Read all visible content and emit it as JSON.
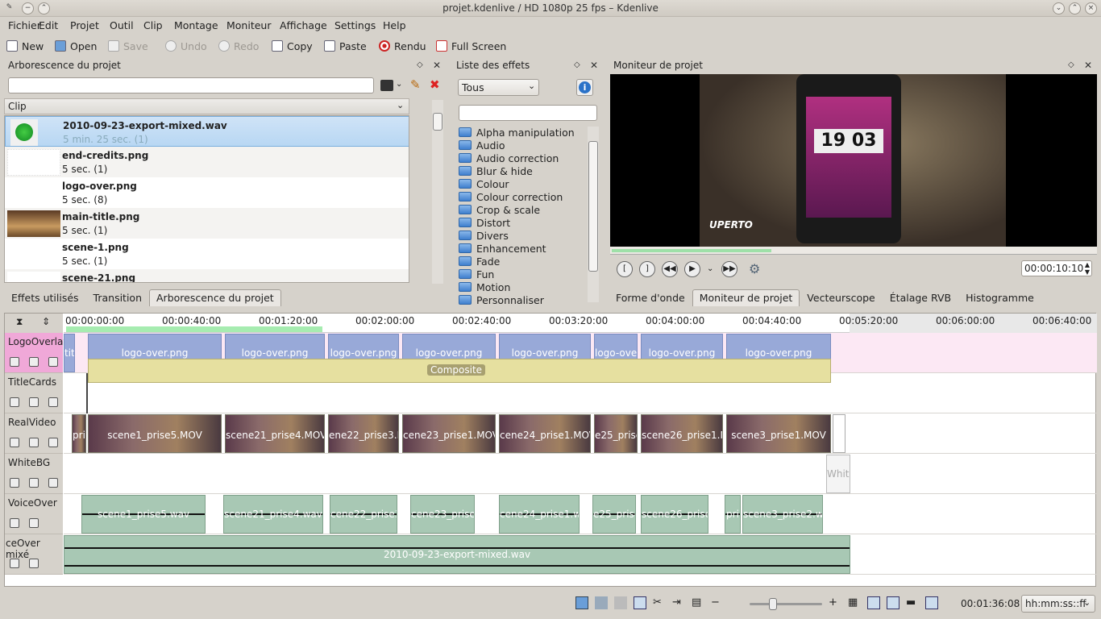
{
  "window": {
    "title": "projet.kdenlive / HD 1080p 25 fps – Kdenlive"
  },
  "menu": [
    "Fichier",
    "Edit",
    "Projet",
    "Outil",
    "Clip",
    "Montage",
    "Moniteur",
    "Affichage",
    "Settings",
    "Help"
  ],
  "toolbar": {
    "new": "New",
    "open": "Open",
    "save": "Save",
    "undo": "Undo",
    "redo": "Redo",
    "copy": "Copy",
    "paste": "Paste",
    "render": "Rendu",
    "fullscreen": "Full Screen"
  },
  "project_tree": {
    "title": "Arborescence du projet",
    "search_value": "",
    "column_header": "Clip",
    "clips": [
      {
        "name": "2010-09-23-export-mixed.wav",
        "duration": "5 min. 25 sec. (1)"
      },
      {
        "name": "end-credits.png",
        "duration": "5 sec. (1)"
      },
      {
        "name": "logo-over.png",
        "duration": "5 sec. (8)"
      },
      {
        "name": "main-title.png",
        "duration": "5 sec. (1)"
      },
      {
        "name": "scene-1.png",
        "duration": "5 sec. (1)"
      },
      {
        "name": "scene-21.png",
        "duration": ""
      }
    ]
  },
  "left_tabs": [
    "Effets utilisés",
    "Transition",
    "Arborescence du projet"
  ],
  "effects": {
    "title": "Liste des effets",
    "filter": "Tous",
    "search_value": "",
    "items": [
      "Alpha manipulation",
      "Audio",
      "Audio correction",
      "Blur & hide",
      "Colour",
      "Colour correction",
      "Crop & scale",
      "Distort",
      "Divers",
      "Enhancement",
      "Fade",
      "Fun",
      "Motion",
      "Personnaliser"
    ]
  },
  "monitor": {
    "title": "Moniteur de projet",
    "timecode": "00:00:10:10",
    "overlay_time": "19 03",
    "brand": "UPERTO"
  },
  "monitor_tabs": [
    "Forme d'onde",
    "Moniteur de projet",
    "Vecteurscope",
    "Étalage RVB",
    "Histogramme"
  ],
  "timeline": {
    "ticks": [
      "00:00:00:00",
      "00:00:40:00",
      "00:01:20:00",
      "00:02:00:00",
      "00:02:40:00",
      "00:03:20:00",
      "00:04:00:00",
      "00:04:40:00",
      "00:05:20:00",
      "00:06:00:00",
      "00:06:40:00"
    ],
    "tracks": [
      "LogoOverlay",
      "TitleCards",
      "RealVideo",
      "WhiteBG",
      "VoiceOver",
      "ceOver mixé"
    ],
    "overlay_clips": [
      "titl",
      "logo-over.png",
      "logo-over.png",
      "logo-over.png",
      "logo-over.png",
      "logo-over.png",
      "logo-over.png",
      "logo-over.png",
      "logo-over.png"
    ],
    "composite": "Composite",
    "video_clips": [
      "pri",
      "scene1_prise5.MOV",
      "scene21_prise4.MOV",
      "ene22_prise3.M",
      "cene23_prise1.MOV",
      "cene24_prise1.MOV",
      "e25_prise",
      "scene26_prise1.MOV",
      "scene3_prise1.MOV",
      "edi"
    ],
    "white_clip": "White",
    "voice_clips": [
      "scene1_prise5.wav",
      "scene21_prise4.wav",
      "cene22_prise3.wav",
      "cene23_prise1.w",
      "cene24_prise1.wa",
      "e25_prise",
      "scene26_prise1.w",
      "pri",
      "scene3_prise2.wav"
    ],
    "mixed_clip": "2010-09-23-export-mixed.wav"
  },
  "status": {
    "position": "00:01:36:08",
    "format": "hh:mm:ss::ff"
  }
}
